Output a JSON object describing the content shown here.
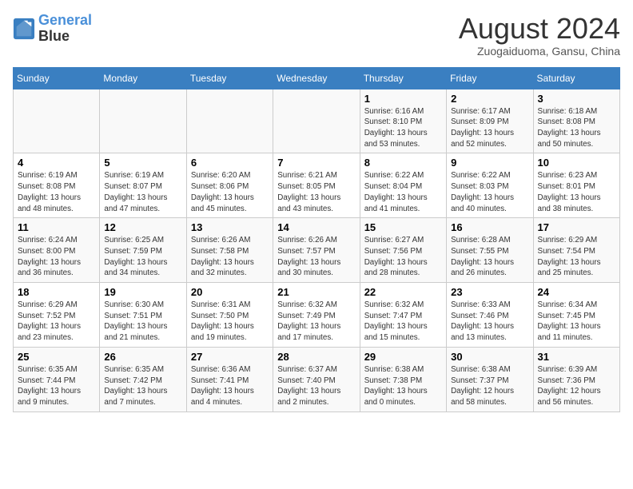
{
  "logo": {
    "line1": "General",
    "line2": "Blue"
  },
  "header": {
    "month": "August 2024",
    "location": "Zuogaiduoma, Gansu, China"
  },
  "weekdays": [
    "Sunday",
    "Monday",
    "Tuesday",
    "Wednesday",
    "Thursday",
    "Friday",
    "Saturday"
  ],
  "weeks": [
    [
      {
        "day": "",
        "info": ""
      },
      {
        "day": "",
        "info": ""
      },
      {
        "day": "",
        "info": ""
      },
      {
        "day": "",
        "info": ""
      },
      {
        "day": "1",
        "info": "Sunrise: 6:16 AM\nSunset: 8:10 PM\nDaylight: 13 hours\nand 53 minutes."
      },
      {
        "day": "2",
        "info": "Sunrise: 6:17 AM\nSunset: 8:09 PM\nDaylight: 13 hours\nand 52 minutes."
      },
      {
        "day": "3",
        "info": "Sunrise: 6:18 AM\nSunset: 8:08 PM\nDaylight: 13 hours\nand 50 minutes."
      }
    ],
    [
      {
        "day": "4",
        "info": "Sunrise: 6:19 AM\nSunset: 8:08 PM\nDaylight: 13 hours\nand 48 minutes."
      },
      {
        "day": "5",
        "info": "Sunrise: 6:19 AM\nSunset: 8:07 PM\nDaylight: 13 hours\nand 47 minutes."
      },
      {
        "day": "6",
        "info": "Sunrise: 6:20 AM\nSunset: 8:06 PM\nDaylight: 13 hours\nand 45 minutes."
      },
      {
        "day": "7",
        "info": "Sunrise: 6:21 AM\nSunset: 8:05 PM\nDaylight: 13 hours\nand 43 minutes."
      },
      {
        "day": "8",
        "info": "Sunrise: 6:22 AM\nSunset: 8:04 PM\nDaylight: 13 hours\nand 41 minutes."
      },
      {
        "day": "9",
        "info": "Sunrise: 6:22 AM\nSunset: 8:03 PM\nDaylight: 13 hours\nand 40 minutes."
      },
      {
        "day": "10",
        "info": "Sunrise: 6:23 AM\nSunset: 8:01 PM\nDaylight: 13 hours\nand 38 minutes."
      }
    ],
    [
      {
        "day": "11",
        "info": "Sunrise: 6:24 AM\nSunset: 8:00 PM\nDaylight: 13 hours\nand 36 minutes."
      },
      {
        "day": "12",
        "info": "Sunrise: 6:25 AM\nSunset: 7:59 PM\nDaylight: 13 hours\nand 34 minutes."
      },
      {
        "day": "13",
        "info": "Sunrise: 6:26 AM\nSunset: 7:58 PM\nDaylight: 13 hours\nand 32 minutes."
      },
      {
        "day": "14",
        "info": "Sunrise: 6:26 AM\nSunset: 7:57 PM\nDaylight: 13 hours\nand 30 minutes."
      },
      {
        "day": "15",
        "info": "Sunrise: 6:27 AM\nSunset: 7:56 PM\nDaylight: 13 hours\nand 28 minutes."
      },
      {
        "day": "16",
        "info": "Sunrise: 6:28 AM\nSunset: 7:55 PM\nDaylight: 13 hours\nand 26 minutes."
      },
      {
        "day": "17",
        "info": "Sunrise: 6:29 AM\nSunset: 7:54 PM\nDaylight: 13 hours\nand 25 minutes."
      }
    ],
    [
      {
        "day": "18",
        "info": "Sunrise: 6:29 AM\nSunset: 7:52 PM\nDaylight: 13 hours\nand 23 minutes."
      },
      {
        "day": "19",
        "info": "Sunrise: 6:30 AM\nSunset: 7:51 PM\nDaylight: 13 hours\nand 21 minutes."
      },
      {
        "day": "20",
        "info": "Sunrise: 6:31 AM\nSunset: 7:50 PM\nDaylight: 13 hours\nand 19 minutes."
      },
      {
        "day": "21",
        "info": "Sunrise: 6:32 AM\nSunset: 7:49 PM\nDaylight: 13 hours\nand 17 minutes."
      },
      {
        "day": "22",
        "info": "Sunrise: 6:32 AM\nSunset: 7:47 PM\nDaylight: 13 hours\nand 15 minutes."
      },
      {
        "day": "23",
        "info": "Sunrise: 6:33 AM\nSunset: 7:46 PM\nDaylight: 13 hours\nand 13 minutes."
      },
      {
        "day": "24",
        "info": "Sunrise: 6:34 AM\nSunset: 7:45 PM\nDaylight: 13 hours\nand 11 minutes."
      }
    ],
    [
      {
        "day": "25",
        "info": "Sunrise: 6:35 AM\nSunset: 7:44 PM\nDaylight: 13 hours\nand 9 minutes."
      },
      {
        "day": "26",
        "info": "Sunrise: 6:35 AM\nSunset: 7:42 PM\nDaylight: 13 hours\nand 7 minutes."
      },
      {
        "day": "27",
        "info": "Sunrise: 6:36 AM\nSunset: 7:41 PM\nDaylight: 13 hours\nand 4 minutes."
      },
      {
        "day": "28",
        "info": "Sunrise: 6:37 AM\nSunset: 7:40 PM\nDaylight: 13 hours\nand 2 minutes."
      },
      {
        "day": "29",
        "info": "Sunrise: 6:38 AM\nSunset: 7:38 PM\nDaylight: 13 hours\nand 0 minutes."
      },
      {
        "day": "30",
        "info": "Sunrise: 6:38 AM\nSunset: 7:37 PM\nDaylight: 12 hours\nand 58 minutes."
      },
      {
        "day": "31",
        "info": "Sunrise: 6:39 AM\nSunset: 7:36 PM\nDaylight: 12 hours\nand 56 minutes."
      }
    ]
  ]
}
